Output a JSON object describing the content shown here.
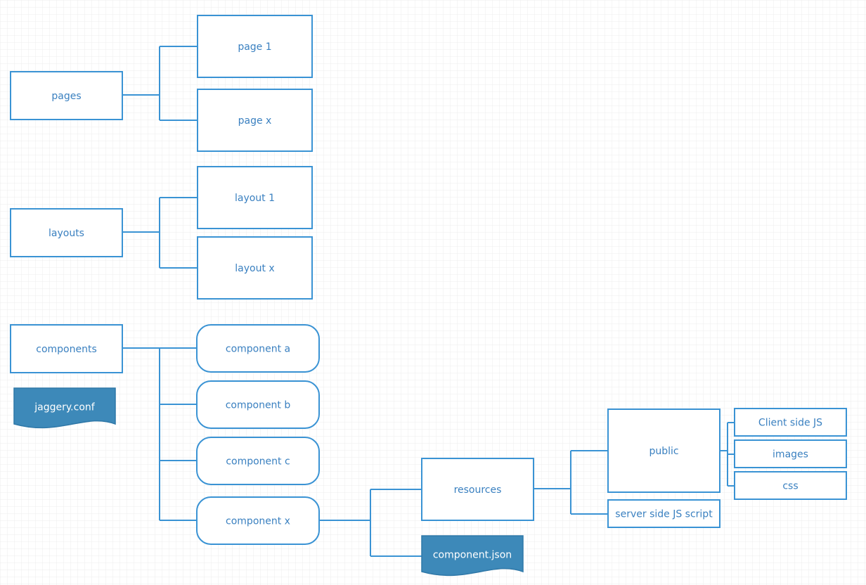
{
  "colors": {
    "stroke": "#3a93d4",
    "text": "#3a80c0",
    "doc_fill": "#3d89b9",
    "doc_text": "#ffffff",
    "grid": "#ececec"
  },
  "nodes": {
    "pages": "pages",
    "page_1": "page 1",
    "page_x": "page x",
    "layouts": "layouts",
    "layout_1": "layout 1",
    "layout_x": "layout x",
    "components": "components",
    "component_a": "component a",
    "component_b": "component b",
    "component_c": "component c",
    "component_x": "component x",
    "jaggery_conf": "jaggery.conf",
    "resources": "resources",
    "component_json": "component.json",
    "public": "public",
    "server_side": "server side JS script",
    "client_side": "Client side JS",
    "images": "images",
    "css": "css"
  }
}
